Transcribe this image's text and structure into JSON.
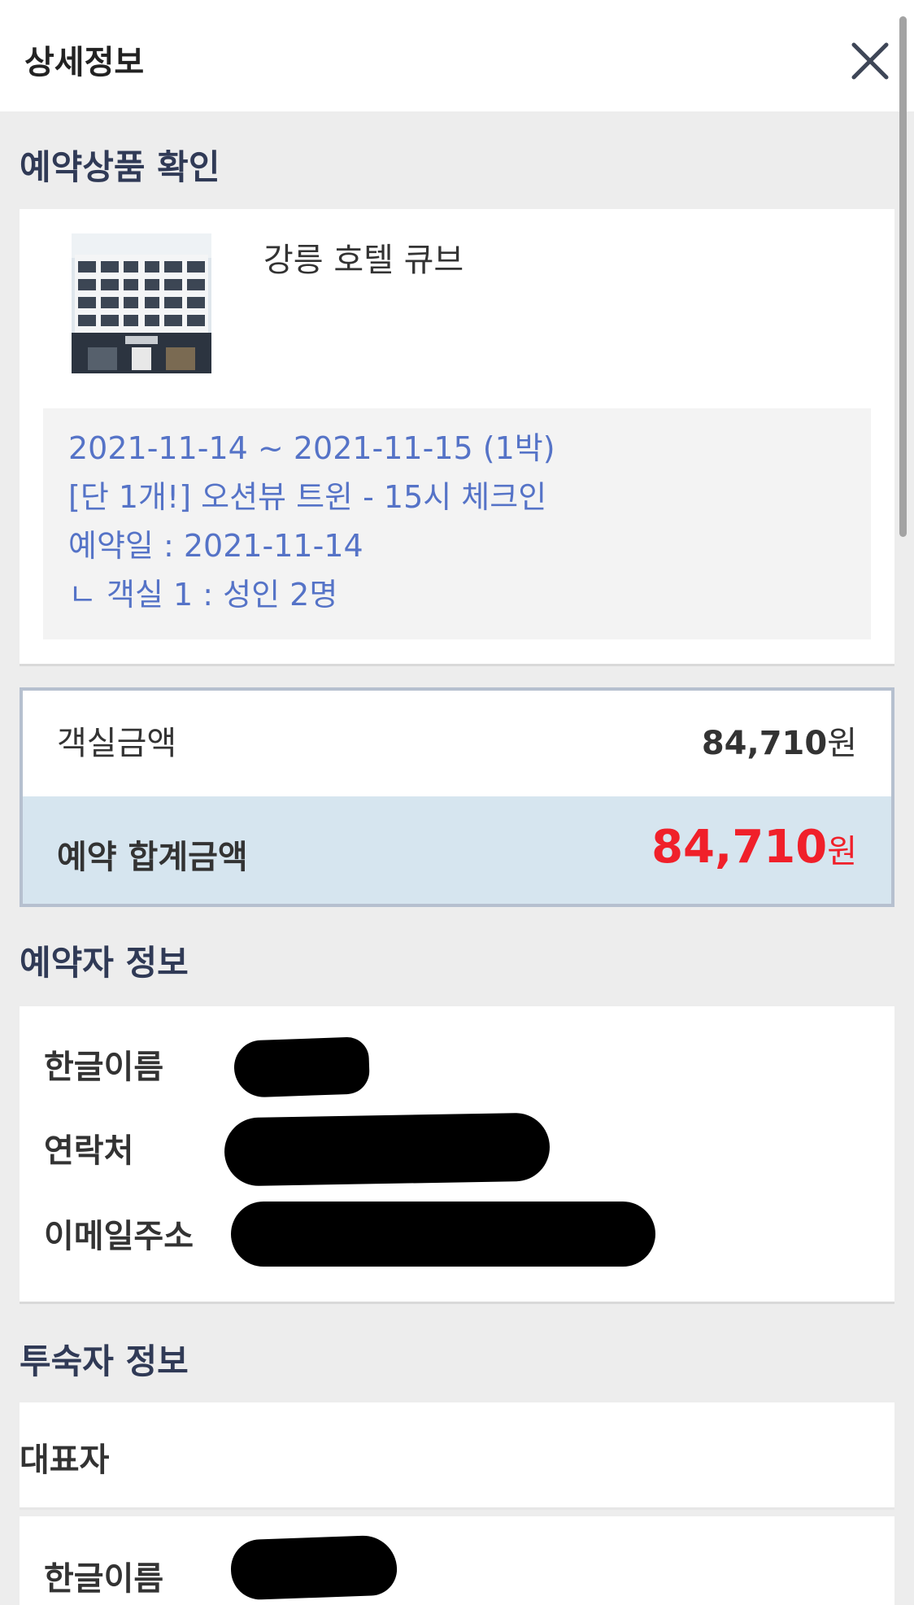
{
  "header": {
    "title": "상세정보",
    "close_icon": "close-icon"
  },
  "product": {
    "section_title": "예약상품 확인",
    "hotel_name": "강릉 호텔 큐브",
    "details": [
      "2021-11-14  ~ 2021-11-15 (1박)",
      "[단 1개!] 오션뷰 트윈 - 15시 체크인",
      "예약일 : 2021-11-14",
      "ㄴ 객실 1 : 성인 2명"
    ]
  },
  "price": {
    "room_label": "객실금액",
    "room_value": "84,710",
    "room_unit": "원",
    "total_label": "예약 합계금액",
    "total_value": "84,710",
    "total_unit": "원"
  },
  "booker": {
    "section_title": "예약자 정보",
    "name_label": "한글이름",
    "phone_label": "연락처",
    "email_label": "이메일주소"
  },
  "guest": {
    "section_title": "투숙자 정보",
    "representative_label": "대표자",
    "name_label": "한글이름"
  },
  "colors": {
    "accent_text": "#303a56",
    "detail_text": "#5573c7",
    "total_price": "#f0202a",
    "total_row_bg": "#d6e5ef"
  }
}
